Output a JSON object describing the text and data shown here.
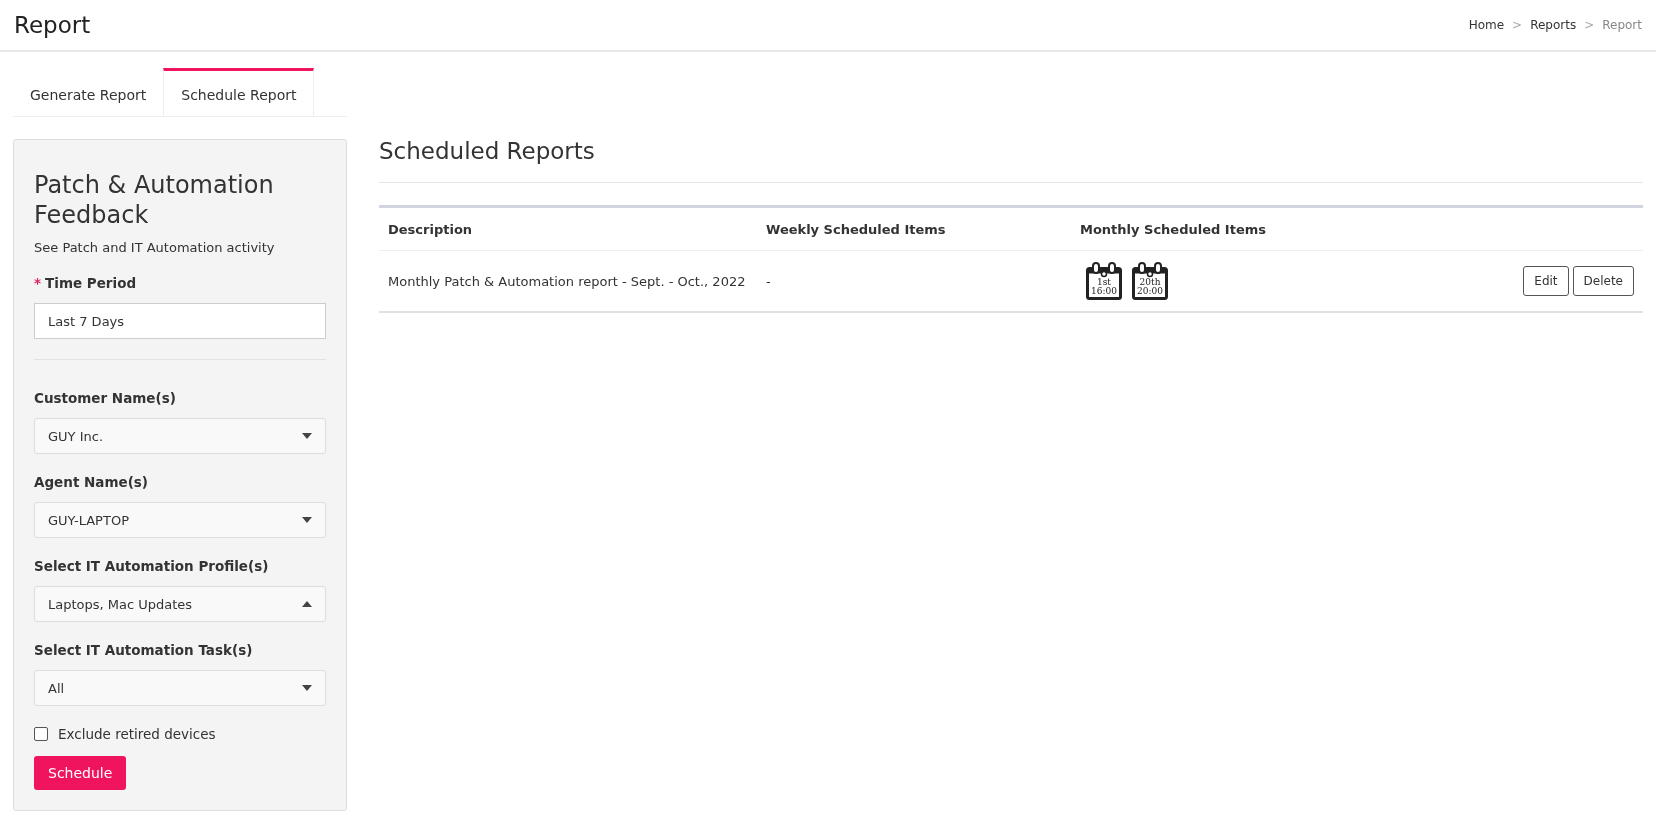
{
  "header": {
    "title": "Report",
    "breadcrumb": [
      {
        "label": "Home",
        "current": false,
        "separator": ">"
      },
      {
        "label": "Reports",
        "current": false,
        "separator": ">"
      },
      {
        "label": "Report",
        "current": true
      }
    ]
  },
  "tabs": [
    {
      "label": "Generate Report",
      "selected": false
    },
    {
      "label": "Schedule Report",
      "selected": true
    }
  ],
  "form": {
    "title": "Patch & Automation Feedback",
    "subtitle": "See Patch and IT Automation activity",
    "fields": [
      {
        "kind": "text",
        "label": "Time Period",
        "required_mark": "*",
        "value": "Last 7 Days"
      },
      {
        "kind": "select",
        "label": "Customer Name(s)",
        "value": "GUY Inc.",
        "expanded": false
      },
      {
        "kind": "select",
        "label": "Agent Name(s)",
        "value": "GUY-LAPTOP",
        "expanded": false
      },
      {
        "kind": "select",
        "label": "Select IT Automation Profile(s)",
        "value": "Laptops, Mac Updates",
        "expanded": true
      },
      {
        "kind": "select",
        "label": "Select IT Automation Task(s)",
        "value": "All",
        "expanded": false
      }
    ],
    "checkbox": {
      "label": "Exclude retired devices",
      "checked": false
    },
    "submit": "Schedule"
  },
  "scheduled": {
    "title": "Scheduled Reports",
    "columns": [
      "Description",
      "Weekly Scheduled Items",
      "Monthly Scheduled Items"
    ],
    "rows": [
      {
        "description": "Monthly Patch & Automation report - Sept. - Oct., 2022",
        "weekly": "-",
        "monthly": [
          {
            "day": "1st",
            "time": "16:00"
          },
          {
            "day": "20th",
            "time": "20:00"
          }
        ],
        "actions": [
          "Edit",
          "Delete"
        ]
      }
    ]
  }
}
